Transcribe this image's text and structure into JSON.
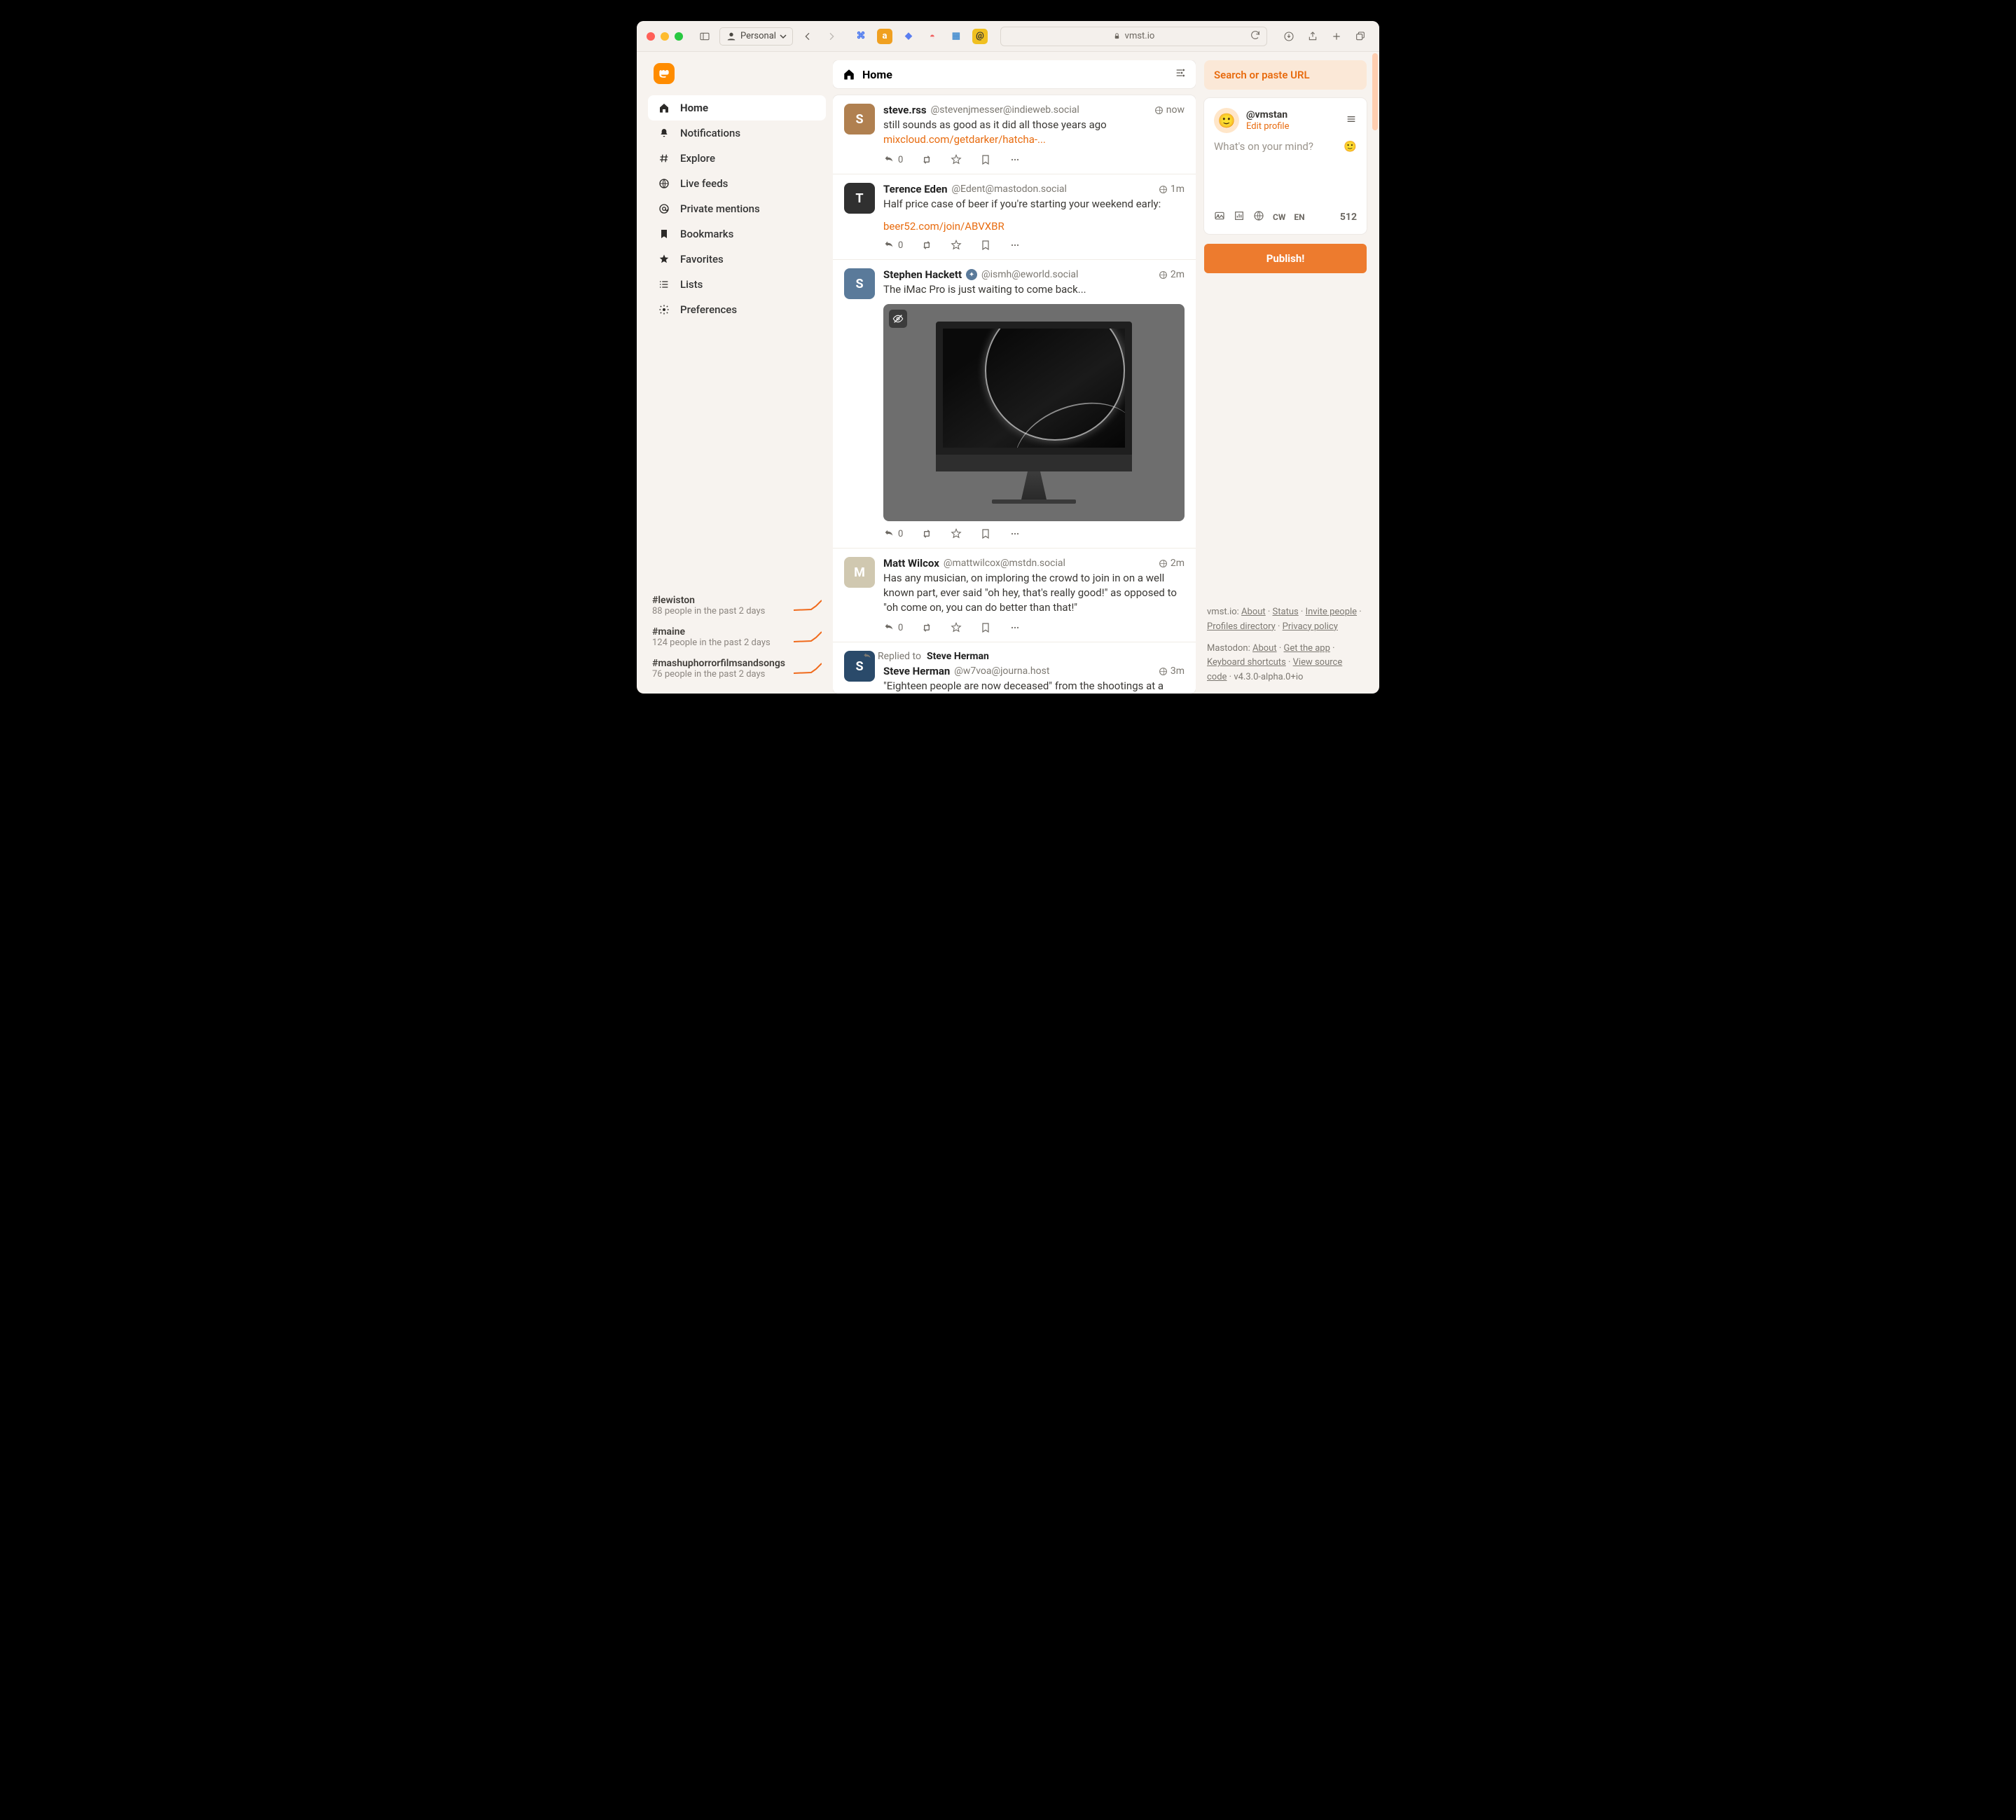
{
  "browser": {
    "group": "Personal",
    "url": "vmst.io"
  },
  "sidebar": {
    "items": [
      {
        "label": "Home",
        "icon": "home",
        "active": true
      },
      {
        "label": "Notifications",
        "icon": "bell"
      },
      {
        "label": "Explore",
        "icon": "hash"
      },
      {
        "label": "Live feeds",
        "icon": "globe"
      },
      {
        "label": "Private mentions",
        "icon": "at"
      },
      {
        "label": "Bookmarks",
        "icon": "bookmark"
      },
      {
        "label": "Favorites",
        "icon": "star"
      },
      {
        "label": "Lists",
        "icon": "list"
      },
      {
        "label": "Preferences",
        "icon": "gear"
      }
    ],
    "trends": [
      {
        "tag": "#lewiston",
        "sub": "88 people in the past 2 days"
      },
      {
        "tag": "#maine",
        "sub": "124 people in the past 2 days"
      },
      {
        "tag": "#mashuphorrorfilmsandsongs",
        "sub": "76 people in the past 2 days"
      }
    ]
  },
  "column": {
    "title": "Home"
  },
  "posts": [
    {
      "display_name": "steve.rss",
      "handle": "@stevenjmesser@indieweb.social",
      "time": "now",
      "avatar_bg": "#b08050",
      "avatar_initial": "S",
      "text": "still sounds as good as it did all those years ago",
      "link": "mixcloud.com/getdarker/hatcha-...",
      "reply_count": "0"
    },
    {
      "display_name": "Terence Eden",
      "handle": "@Edent@mastodon.social",
      "time": "1m",
      "avatar_bg": "#303030",
      "avatar_initial": "T",
      "text": "Half price case of beer if you're starting your weekend early:",
      "link_block": "beer52.com/join/ABVXBR",
      "reply_count": "0"
    },
    {
      "display_name": "Stephen Hackett",
      "handle": "@ismh@eworld.social",
      "verified_badge": true,
      "time": "2m",
      "avatar_bg": "#5a7a9a",
      "avatar_initial": "S",
      "text": "The iMac Pro is just waiting to come back...",
      "has_media": true,
      "reply_count": "0"
    },
    {
      "display_name": "Matt Wilcox",
      "handle": "@mattwilcox@mstdn.social",
      "time": "2m",
      "avatar_bg": "#d0c8b0",
      "avatar_initial": "M",
      "text": "Has any musician, on imploring the crowd to join in on a well known part, ever said \"oh hey, that's really good!\" as opposed to \"oh come on, you can do better than that!\"",
      "reply_count": "0"
    },
    {
      "reply_to": "Steve Herman",
      "display_name": "Steve Herman",
      "handle": "@w7voa@journa.host",
      "time": "3m",
      "avatar_bg": "#2a4a6a",
      "avatar_initial": "S",
      "text": "\"Eighteen people are now deceased\" from the shootings at a bowling alley and a billiards bar in Lewiston, Maine State Police Col. William Ross tells reporters. Eight of the victims have been identified but ten have not yet."
    }
  ],
  "strings": {
    "replied_to_prefix": "Replied to "
  },
  "compose": {
    "search_placeholder": "Search or paste URL",
    "username": "@vmstan",
    "edit_profile": "Edit profile",
    "placeholder": "What's on your mind?",
    "cw_label": "CW",
    "lang": "EN",
    "counter": "512",
    "publish": "Publish!"
  },
  "footer": {
    "instance": "vmst.io",
    "about": "About",
    "status": "Status",
    "invite": "Invite people",
    "profiles": "Profiles directory",
    "privacy": "Privacy policy",
    "mastodon_label": "Mastodon",
    "mastodon_about": "About",
    "get_app": "Get the app",
    "shortcuts": "Keyboard shortcuts",
    "source": "View source code",
    "version": "v4.3.0-alpha.0+io"
  }
}
